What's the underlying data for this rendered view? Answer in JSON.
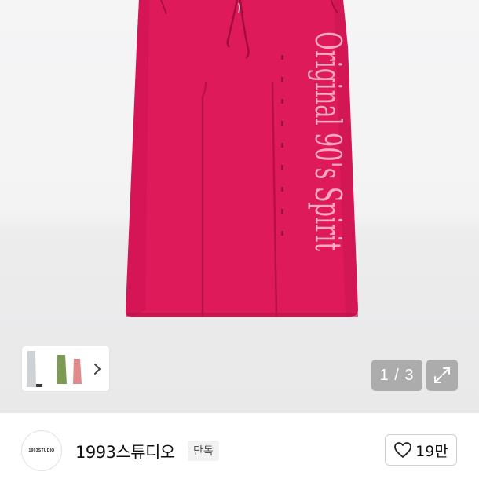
{
  "product": {
    "print_text": "Original 90's Spirit",
    "side_text": "1993STUDIO",
    "colors": {
      "skirt": "#df1a5b",
      "print": "#f7a9c2"
    },
    "thumbnail_variants": [
      "#cfd2d4",
      "#7d9a55",
      "#e08a8e"
    ]
  },
  "gallery": {
    "counter": "1 / 3",
    "expand_icon": "expand-icon",
    "next_icon": "chevron-right-icon"
  },
  "seller": {
    "avatar_text": "1993STUDIO",
    "name": "1993스튜디오",
    "badge": "단독",
    "likes": "19만",
    "like_icon": "heart-outline-icon"
  }
}
